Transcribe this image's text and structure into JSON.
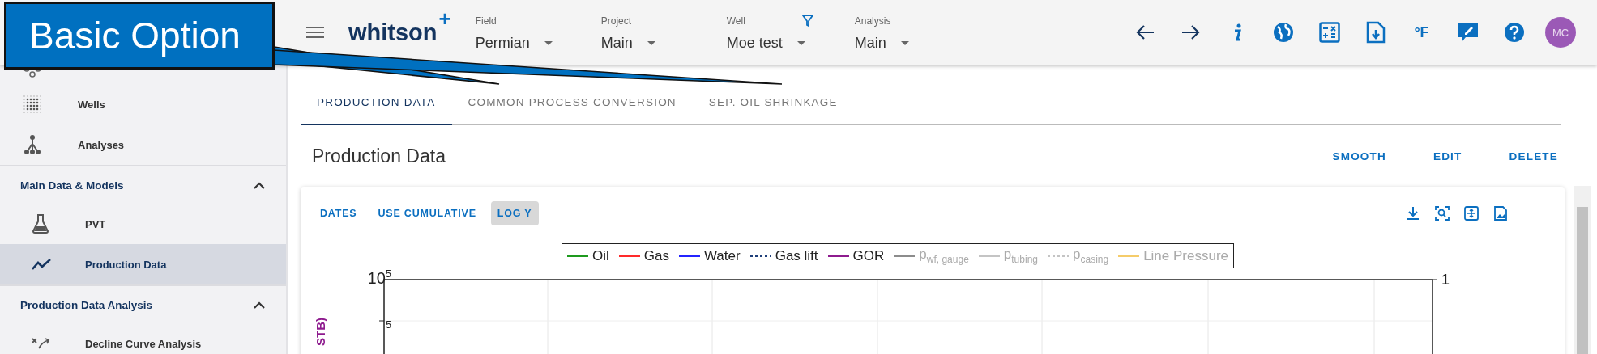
{
  "callout": {
    "text": "Basic Option"
  },
  "topbar": {
    "logo": "whitson",
    "logo_mark": "+",
    "selectors": [
      {
        "label": "Field",
        "value": "Permian",
        "filter": false
      },
      {
        "label": "Project",
        "value": "Main",
        "filter": false
      },
      {
        "label": "Well",
        "value": "Moe test",
        "filter": true
      },
      {
        "label": "Analysis",
        "value": "Main",
        "filter": false
      }
    ],
    "temperature_unit": "°F",
    "avatar": "MC"
  },
  "sidebar": {
    "items": [
      {
        "label": "Wells",
        "kind": "wells"
      },
      {
        "label": "Analyses",
        "kind": "analyses"
      }
    ],
    "sections": [
      {
        "title": "Main Data & Models",
        "expanded": true,
        "items": [
          {
            "label": "PVT",
            "kind": "pvt",
            "selected": false
          },
          {
            "label": "Production Data",
            "kind": "production",
            "selected": true
          }
        ]
      },
      {
        "title": "Production Data Analysis",
        "expanded": true,
        "items": [
          {
            "label": "Decline Curve Analysis",
            "kind": "decline",
            "selected": false
          }
        ]
      }
    ]
  },
  "tabs": [
    {
      "label": "PRODUCTION DATA",
      "selected": true
    },
    {
      "label": "COMMON PROCESS CONVERSION",
      "selected": false
    },
    {
      "label": "SEP. OIL SHRINKAGE",
      "selected": false
    }
  ],
  "panel": {
    "title": "Production Data",
    "actions": [
      "SMOOTH",
      "EDIT",
      "DELETE"
    ]
  },
  "chart": {
    "toggles": [
      {
        "label": "DATES",
        "selected": false
      },
      {
        "label": "USE CUMULATIVE",
        "selected": false
      },
      {
        "label": "LOG Y",
        "selected": true
      }
    ],
    "legend": [
      {
        "label": "Oil",
        "color": "#1e9a1e",
        "kind": "solid",
        "hidden": false
      },
      {
        "label": "Gas",
        "color": "#ff2a2a",
        "kind": "solid",
        "hidden": false
      },
      {
        "label": "Water",
        "color": "#2424ff",
        "kind": "solid",
        "hidden": false
      },
      {
        "label": "Gas lift",
        "color": "#1f3f7a",
        "kind": "dashed",
        "hidden": false
      },
      {
        "label": "GOR",
        "color": "#8e1b8e",
        "kind": "solid",
        "hidden": false
      },
      {
        "label": "p$_{wf, gauge}$",
        "color": "#8c8c8c",
        "kind": "solid",
        "hidden": true
      },
      {
        "label": "p$_{tubing}$",
        "color": "#c4c4c4",
        "kind": "solid",
        "hidden": true
      },
      {
        "label": "p$_{casing}$",
        "color": "#c4c4c4",
        "kind": "dashed",
        "hidden": true
      },
      {
        "label": "Line Pressure",
        "color": "#f5cc6a",
        "kind": "solid",
        "hidden": true
      }
    ],
    "y_ticks": [
      "10$^{5}$",
      "5"
    ],
    "y2_ticks": [
      "1"
    ],
    "y_axis_label": "STB)"
  }
}
